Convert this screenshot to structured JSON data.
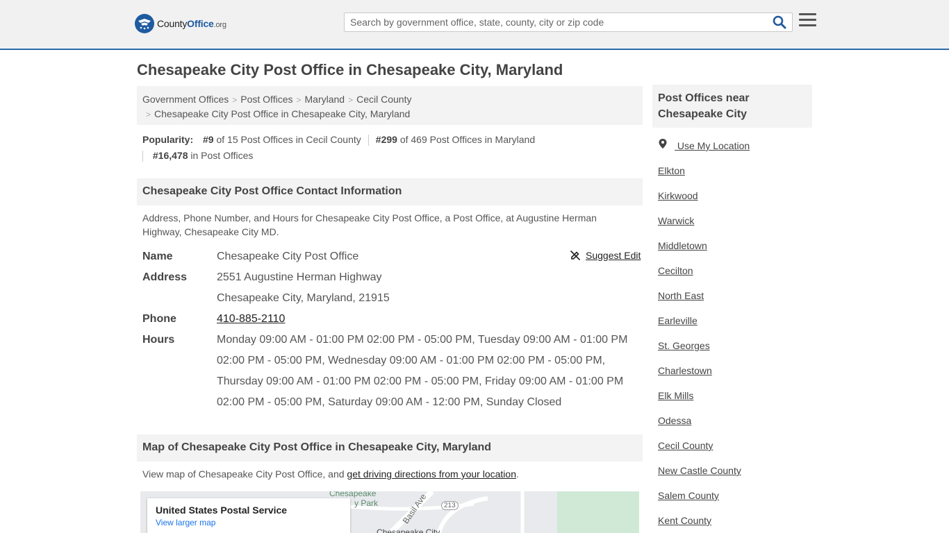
{
  "header": {
    "logo_main": "CountyOffice",
    "logo_suffix": ".org",
    "search_placeholder": "Search by government office, state, county, city or zip code"
  },
  "page": {
    "title": "Chesapeake City Post Office in Chesapeake City, Maryland"
  },
  "breadcrumb": [
    "Government Offices",
    "Post Offices",
    "Maryland",
    "Cecil County",
    "Chesapeake City Post Office in Chesapeake City, Maryland"
  ],
  "popularity": {
    "label": "Popularity:",
    "rank1": "#9",
    "rank1_text": "of 15 Post Offices in Cecil County",
    "rank2": "#299",
    "rank2_text": "of 469 Post Offices in Maryland",
    "rank3": "#16,478",
    "rank3_text": "in Post Offices"
  },
  "contact": {
    "heading": "Chesapeake City Post Office Contact Information",
    "description": "Address, Phone Number, and Hours for Chesapeake City Post Office, a Post Office, at Augustine Herman Highway, Chesapeake City MD.",
    "suggest_edit": "Suggest Edit",
    "name_label": "Name",
    "name": "Chesapeake City Post Office",
    "address_label": "Address",
    "address_line1": "2551 Augustine Herman Highway",
    "address_line2": "Chesapeake City, Maryland, 21915",
    "phone_label": "Phone",
    "phone": "410-885-2110",
    "hours_label": "Hours",
    "hours_line1": "Monday 09:00 AM - 01:00 PM 02:00 PM - 05:00 PM, Tuesday 09:00 AM - 01:00 PM",
    "hours_line2": "02:00 PM - 05:00 PM, Wednesday 09:00 AM - 01:00 PM 02:00 PM - 05:00 PM,",
    "hours_line3": "Thursday 09:00 AM - 01:00 PM 02:00 PM - 05:00 PM, Friday 09:00 AM - 01:00 PM",
    "hours_line4": "02:00 PM - 05:00 PM, Saturday 09:00 AM - 12:00 PM, Sunday Closed"
  },
  "map": {
    "heading": "Map of Chesapeake City Post Office in Chesapeake City, Maryland",
    "desc_prefix": "View map of Chesapeake City Post Office, and",
    "desc_link": "get driving directions from your location",
    "desc_suffix": ".",
    "card_title": "United States Postal Service",
    "card_link": "View larger map",
    "park_label1": "Chesapeake",
    "park_label2": "y Park",
    "road_label": "Basil Ave",
    "route_label": "213",
    "city_label": "Chesapeake City"
  },
  "sidebar": {
    "heading": "Post Offices near Chesapeake City",
    "use_location": "Use My Location",
    "links": [
      "Elkton",
      "Kirkwood",
      "Warwick",
      "Middletown",
      "Cecilton",
      "North East",
      "Earleville",
      "St. Georges",
      "Charlestown",
      "Elk Mills",
      "Odessa",
      "Cecil County",
      "New Castle County",
      "Salem County",
      "Kent County"
    ]
  },
  "colors": {
    "brand_blue": "#1f5aa0",
    "header_border": "#2b6aa8",
    "section_bg": "#f3f3f3"
  },
  "icons": [
    "countyoffice-logo-icon",
    "search-icon",
    "menu-icon",
    "suggest-edit-icon",
    "location-pin-icon"
  ]
}
